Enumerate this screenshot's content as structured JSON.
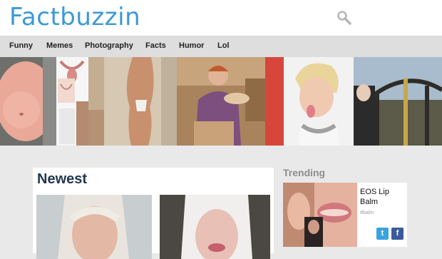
{
  "site": {
    "logo_text": "Factbuzzin"
  },
  "header": {
    "search_icon": "search-icon"
  },
  "nav": {
    "items": [
      "Funny",
      "Memes",
      "Photography",
      "Facts",
      "Humor",
      "Lol"
    ]
  },
  "newest": {
    "title": "Newest"
  },
  "trending": {
    "title": "Trending",
    "card_title": "EOS Lip Balm",
    "card_subtitle": "#balm",
    "social": {
      "twitter_label": "t",
      "facebook_label": "f"
    }
  },
  "colors": {
    "brand": "#3b9ad6",
    "nav_bg": "#dedede",
    "page_bg": "#e9e9e9",
    "heading": "#23384f",
    "twitter": "#3aa3dd",
    "facebook": "#3b5a9a"
  }
}
